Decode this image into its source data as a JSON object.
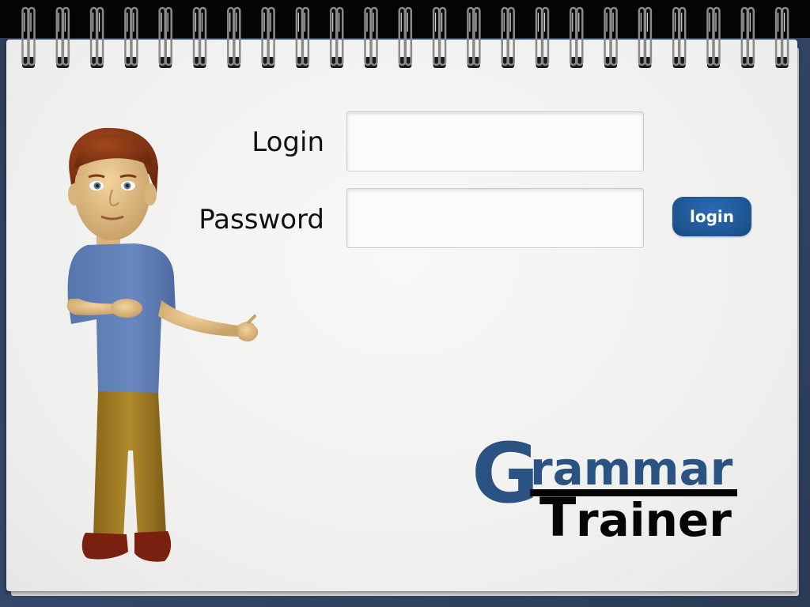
{
  "form": {
    "login_label": "Login",
    "password_label": "Password",
    "login_value": "",
    "password_value": "",
    "submit_label": "login"
  },
  "logo": {
    "first_letter": "G",
    "first_word_rest": "rammar",
    "second_letter": "T",
    "second_word_rest": "rainer"
  },
  "colors": {
    "brand_blue": "#2a5384",
    "button_blue": "#1f5a97",
    "logo_black": "#050505",
    "paper": "#f2f2f1",
    "background": "#2e3f5a"
  },
  "icons": {
    "character": "cartoon-teacher-figure",
    "binding": "spiral-rings"
  }
}
